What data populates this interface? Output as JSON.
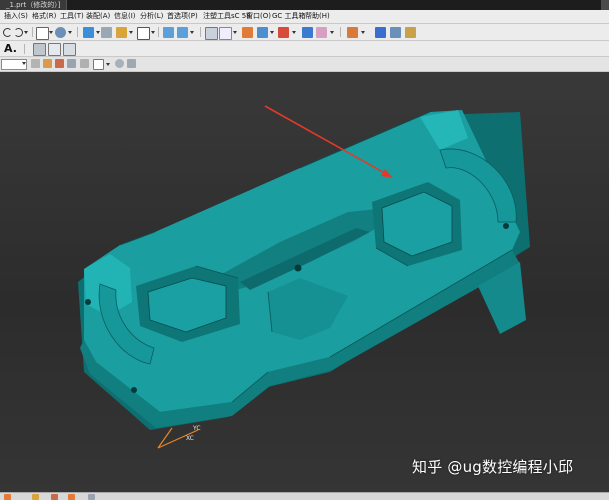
{
  "window": {
    "doc_tab_label": "_1.prt（修改的）]"
  },
  "menus": [
    {
      "label": "插入(S)"
    },
    {
      "label": "格式(R)"
    },
    {
      "label": "工具(T)"
    },
    {
      "label": "装配(A)"
    },
    {
      "label": "信息(I)"
    },
    {
      "label": "分析(L)"
    },
    {
      "label": "首选项(P)"
    },
    {
      "label": "注塑工具sC 58"
    },
    {
      "label": "窗口(O)"
    },
    {
      "label": "GC 工具箱"
    },
    {
      "label": "帮助(H)"
    }
  ],
  "toolbar2": {
    "text_tool_label": "A."
  },
  "viewport": {
    "axis_labels": {
      "x": "XC",
      "y": "YC"
    },
    "model_color": "#1a9ea0",
    "arrow_color": "#e23a2a",
    "background_color": "#333333"
  },
  "watermark": {
    "text": "知乎 @ug数控编程小邱"
  },
  "icons": [
    "new-file-icon",
    "undo-icon",
    "redo-icon",
    "cube-icon",
    "layer-icon",
    "render-icon",
    "snap-icon",
    "measure-icon",
    "view-icon",
    "zoom-icon",
    "hole-icon"
  ]
}
